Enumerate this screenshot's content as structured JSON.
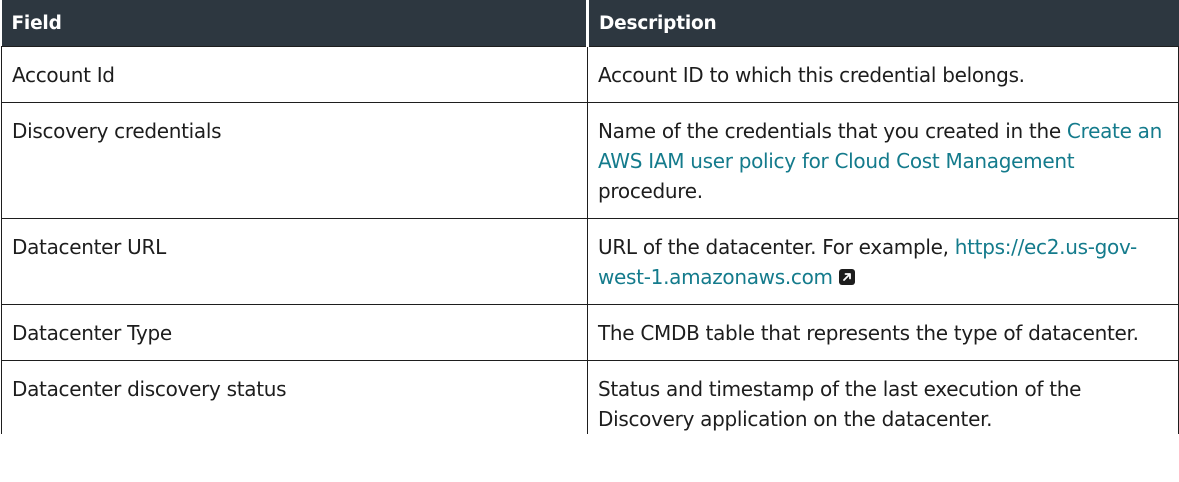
{
  "table": {
    "header": {
      "field": "Field",
      "description": "Description"
    },
    "rows": [
      {
        "field": "Account Id",
        "description": "Account ID to which this credential belongs."
      },
      {
        "field": "Discovery credentials",
        "description_before": "Name of the credentials that you created in the ",
        "description_link": "Create an AWS IAM user policy for Cloud Cost Management",
        "description_after": " procedure."
      },
      {
        "field": "Datacenter URL",
        "description_before": "URL of the datacenter. For example, ",
        "description_link": "https://ec2.us-gov-west-1.amazonaws.com",
        "external_link_icon": "external-link-icon"
      },
      {
        "field": "Datacenter Type",
        "description": "The CMDB table that represents the type of datacenter."
      },
      {
        "field": "Datacenter discovery status",
        "description": "Status and timestamp of the last execution of the Discovery application on the datacenter."
      }
    ]
  },
  "colors": {
    "header_bg": "#2d3740",
    "header_text": "#ffffff",
    "link": "#147b8c",
    "text": "#1d1d1d",
    "border": "#1e1e1e"
  }
}
